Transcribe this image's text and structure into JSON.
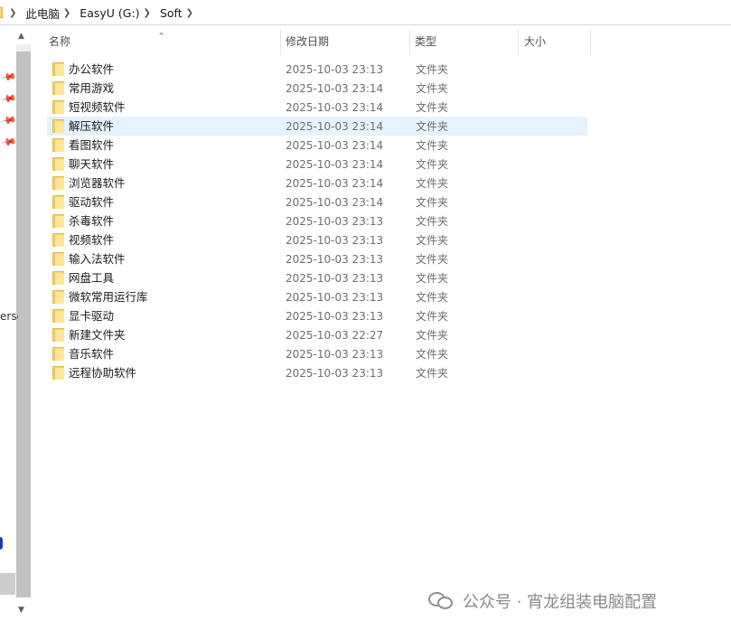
{
  "breadcrumb": {
    "items": [
      "此电脑",
      "EasyU (G:)",
      "Soft"
    ]
  },
  "nav": {
    "clipped_text": "erso"
  },
  "columns": {
    "name": "名称",
    "date": "修改日期",
    "type": "类型",
    "size": "大小",
    "sort_indicator": "^"
  },
  "files": [
    {
      "name": "办公软件",
      "date": "2025-10-03 23:13",
      "type": "文件夹",
      "selected": false
    },
    {
      "name": "常用游戏",
      "date": "2025-10-03 23:14",
      "type": "文件夹",
      "selected": false
    },
    {
      "name": "短视频软件",
      "date": "2025-10-03 23:14",
      "type": "文件夹",
      "selected": false
    },
    {
      "name": "解压软件",
      "date": "2025-10-03 23:14",
      "type": "文件夹",
      "selected": true
    },
    {
      "name": "看图软件",
      "date": "2025-10-03 23:14",
      "type": "文件夹",
      "selected": false
    },
    {
      "name": "聊天软件",
      "date": "2025-10-03 23:14",
      "type": "文件夹",
      "selected": false
    },
    {
      "name": "浏览器软件",
      "date": "2025-10-03 23:14",
      "type": "文件夹",
      "selected": false
    },
    {
      "name": "驱动软件",
      "date": "2025-10-03 23:14",
      "type": "文件夹",
      "selected": false
    },
    {
      "name": "杀毒软件",
      "date": "2025-10-03 23:13",
      "type": "文件夹",
      "selected": false
    },
    {
      "name": "视频软件",
      "date": "2025-10-03 23:13",
      "type": "文件夹",
      "selected": false
    },
    {
      "name": "输入法软件",
      "date": "2025-10-03 23:13",
      "type": "文件夹",
      "selected": false
    },
    {
      "name": "网盘工具",
      "date": "2025-10-03 23:13",
      "type": "文件夹",
      "selected": false
    },
    {
      "name": "微软常用运行库",
      "date": "2025-10-03 23:13",
      "type": "文件夹",
      "selected": false
    },
    {
      "name": "显卡驱动",
      "date": "2025-10-03 23:13",
      "type": "文件夹",
      "selected": false
    },
    {
      "name": "新建文件夹",
      "date": "2025-10-03 22:27",
      "type": "文件夹",
      "selected": false
    },
    {
      "name": "音乐软件",
      "date": "2025-10-03 23:13",
      "type": "文件夹",
      "selected": false
    },
    {
      "name": "远程协助软件",
      "date": "2025-10-03 23:13",
      "type": "文件夹",
      "selected": false
    }
  ],
  "watermark": {
    "text": "公众号 · 宵龙组装电脑配置"
  },
  "colors": {
    "selected_row": "#e5f3ff",
    "folder": "#f9d46c"
  }
}
